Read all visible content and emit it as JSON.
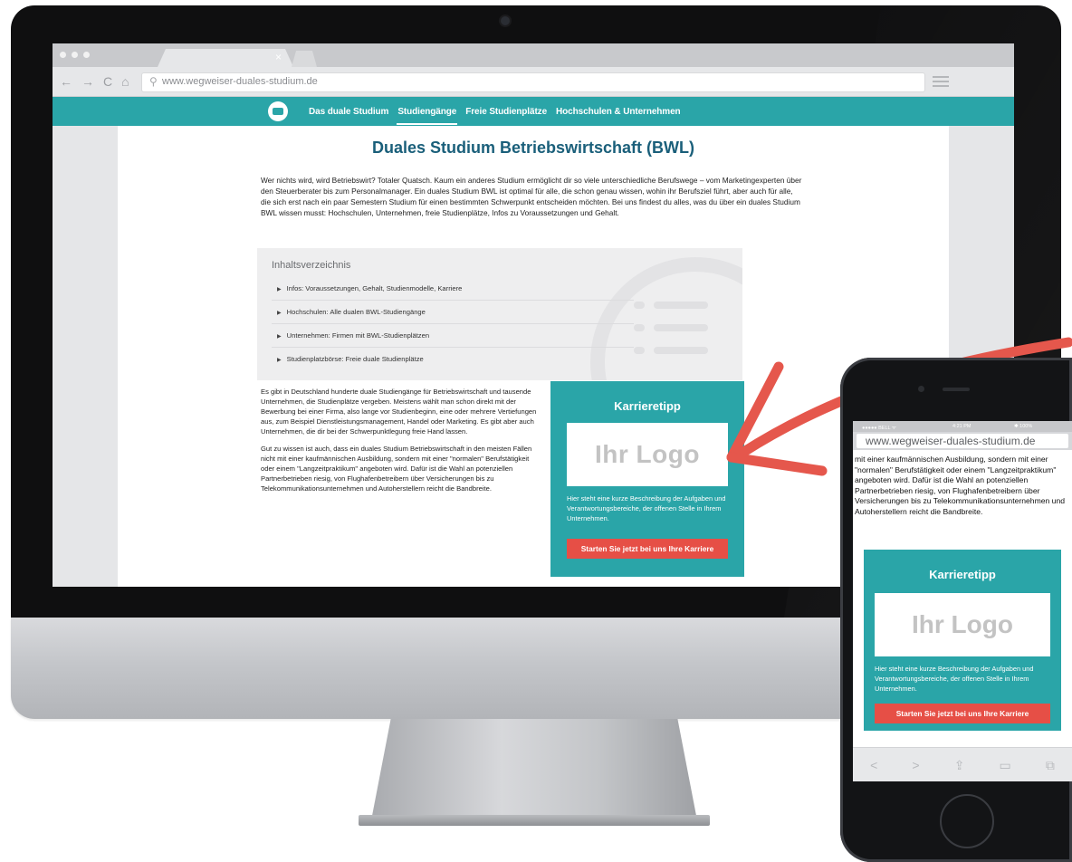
{
  "browser": {
    "tab_close_glyph": "×",
    "url": "www.wegweiser-duales-studium.de",
    "nav_glyphs": [
      "←",
      "→",
      "C",
      "⌂"
    ]
  },
  "site_nav": {
    "items": [
      {
        "label": "Das duale Studium"
      },
      {
        "label": "Studiengänge"
      },
      {
        "label": "Freie Studienplätze"
      },
      {
        "label": "Hochschulen & Unternehmen"
      }
    ],
    "active_index": 1
  },
  "page": {
    "title": "Duales Studium Betriebswirtschaft (BWL)",
    "intro": "Wer nichts wird, wird Betriebswirt? Totaler Quatsch. Kaum ein anderes Studium ermöglicht dir so viele unterschiedliche Berufswege – vom Marketingexperten über den Steuerberater bis zum Personalmanager. Ein duales Studium BWL ist optimal für alle, die schon genau wissen, wohin ihr Berufsziel führt, aber auch für alle, die sich erst nach ein paar Semestern Studium für einen bestimmten Schwerpunkt entscheiden möchten. Bei uns findest du alles, was du über ein duales Studium BWL wissen musst: Hochschulen, Unternehmen, freie Studienplätze, Infos zu Voraussetzungen und Gehalt.",
    "toc": {
      "title": "Inhaltsverzeichnis",
      "items": [
        {
          "label": "Infos: Voraussetzungen, Gehalt, Studienmodelle, Karriere"
        },
        {
          "label": "Hochschulen: Alle dualen BWL-Studiengänge"
        },
        {
          "label": "Unternehmen: Firmen mit BWL-Studienplätzen"
        },
        {
          "label": "Studienplatzbörse: Freie duale Studienplätze"
        }
      ]
    },
    "body_paragraphs": [
      "Es gibt in Deutschland hunderte duale Studiengänge für Betriebswirtschaft und tausende Unternehmen, die Studienplätze vergeben. Meistens wählt man schon direkt mit der Bewerbung bei einer Firma, also lange vor Studienbeginn, eine oder mehrere Vertiefungen aus, zum Beispiel Dienstleistungsmanagement, Handel oder Marketing. Es gibt aber auch Unternehmen, die dir bei der Schwerpunktlegung freie Hand lassen.",
      "Gut zu wissen ist auch, dass ein duales Studium Betriebswirtschaft in den meisten Fällen nicht mit einer kaufmännischen Ausbildung, sondern mit einer \"normalen\" Berufstätigkeit oder einem \"Langzeitpraktikum\" angeboten wird. Dafür ist die Wahl an potenziellen Partnerbetrieben riesig, von Flughafenbetreibern über Versicherungen bis zu Telekommunikationsunternehmen und Autoherstellern reicht die Bandbreite."
    ],
    "karriere": {
      "title": "Karrieretipp",
      "logo_text": "Ihr Logo",
      "description": "Hier steht eine kurze Beschreibung der Aufgaben und Verantwortungsbereiche, der offenen Stelle in Ihrem Unternehmen.",
      "button": "Starten Sie jetzt bei uns Ihre Karriere"
    }
  },
  "phone": {
    "status_left": "●●●●● BELL ᯤ",
    "status_time": "4:21 PM",
    "status_right": "✱ 100%",
    "url": "www.wegweiser-duales-studium.de",
    "text": "mit einer kaufmännischen Ausbildung, sondern mit einer \"normalen\" Berufstätigkeit oder einem \"Langzeitpraktikum\" angeboten wird. Dafür ist die Wahl an potenziellen Partnerbetrieben riesig, von Flughafenbetreibern über Versicherungen bis zu Telekommunikationsunternehmen und Autoherstellern reicht die Bandbreite.",
    "karriere": {
      "title": "Karrieretipp",
      "logo_text": "Ihr Logo",
      "description": "Hier steht eine kurze Beschreibung der Aufgaben und Verantwortungsbereiche, der offenen Stelle in Ihrem Unternehmen.",
      "button": "Starten Sie jetzt bei uns Ihre Karriere"
    },
    "toolbar_glyphs": [
      "<",
      ">",
      "⇪",
      "▭",
      "⧉"
    ]
  },
  "colors": {
    "teal": "#2aa5a8",
    "title_blue": "#1a5f7a",
    "cta_red": "#e64f46",
    "arrow_red": "#e5574c"
  }
}
